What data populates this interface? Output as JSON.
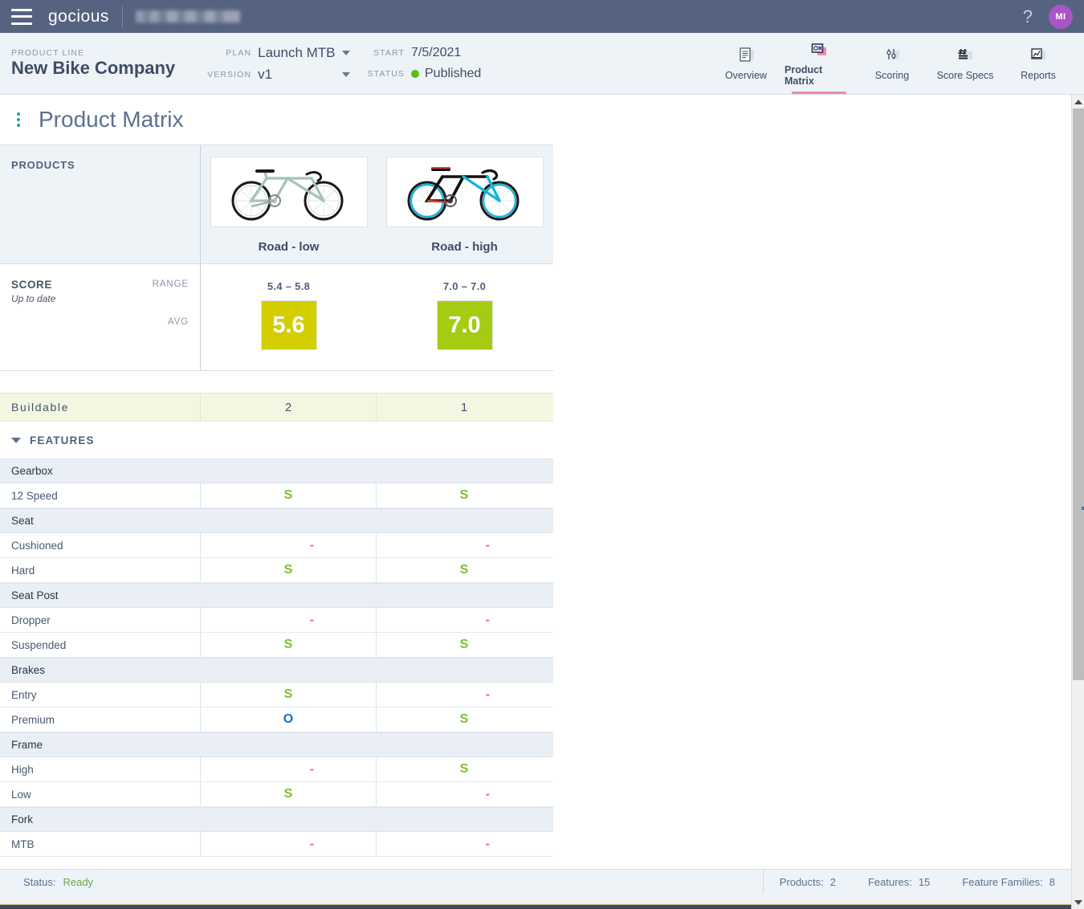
{
  "topbar": {
    "brand": "gocious",
    "redacted_label": "",
    "help_label": "?",
    "avatar_initials": "MI",
    "bg": "#566380"
  },
  "context": {
    "product_line_label": "PRODUCT LINE",
    "product_line_name": "New Bike Company",
    "plan_label": "PLAN",
    "plan_value": "Launch MTB",
    "version_label": "VERSION",
    "version_value": "v1",
    "start_label": "START",
    "start_value": "7/5/2021",
    "status_label": "STATUS",
    "status_value": "Published",
    "status_color": "#4fc11a"
  },
  "nav": {
    "items": [
      {
        "label": "Overview",
        "icon": "document-icon",
        "active": false
      },
      {
        "label": "Product Matrix",
        "icon": "matrix-icon",
        "active": true
      },
      {
        "label": "Scoring",
        "icon": "sliders-icon",
        "active": false
      },
      {
        "label": "Score Specs",
        "icon": "hash-lines-icon",
        "active": false
      },
      {
        "label": "Reports",
        "icon": "chart-icon",
        "active": false
      }
    ],
    "active_underline_color": "#f08ba8"
  },
  "page": {
    "title": "Product Matrix",
    "menu_icon": "kebab-menu-icon"
  },
  "matrix": {
    "products_label": "PRODUCTS",
    "products": [
      {
        "name": "Road - low",
        "thumb": "road-bike-low-image"
      },
      {
        "name": "Road - high",
        "thumb": "road-bike-high-image"
      }
    ],
    "score": {
      "title": "SCORE",
      "subtitle": "Up to date",
      "range_label": "RANGE",
      "avg_label": "AVG",
      "cells": [
        {
          "range": "5.4 – 5.8",
          "avg": "5.6",
          "color": "#d2ce00"
        },
        {
          "range": "7.0 – 7.0",
          "avg": "7.0",
          "color": "#a5cc12"
        }
      ]
    },
    "buildable": {
      "label": "Buildable",
      "values": [
        "2",
        "1"
      ],
      "bg": "#f3f7e1"
    },
    "features_header": "FEATURES",
    "families": [
      {
        "name": "Gearbox",
        "features": [
          {
            "name": "12 Speed",
            "marks": [
              "S",
              "S"
            ]
          }
        ]
      },
      {
        "name": "Seat",
        "features": [
          {
            "name": "Cushioned",
            "marks": [
              "-",
              "-"
            ]
          },
          {
            "name": "Hard",
            "marks": [
              "S",
              "S"
            ]
          }
        ]
      },
      {
        "name": "Seat Post",
        "features": [
          {
            "name": "Dropper",
            "marks": [
              "-",
              "-"
            ]
          },
          {
            "name": "Suspended",
            "marks": [
              "S",
              "S"
            ]
          }
        ]
      },
      {
        "name": "Brakes",
        "features": [
          {
            "name": "Entry",
            "marks": [
              "S",
              "-"
            ]
          },
          {
            "name": "Premium",
            "marks": [
              "O",
              "S"
            ]
          }
        ]
      },
      {
        "name": "Frame",
        "features": [
          {
            "name": "High",
            "marks": [
              "-",
              "S"
            ]
          },
          {
            "name": "Low",
            "marks": [
              "S",
              "-"
            ]
          }
        ]
      },
      {
        "name": "Fork",
        "features": [
          {
            "name": "MTB",
            "marks": [
              "-",
              "-"
            ]
          }
        ]
      }
    ],
    "mark_colors": {
      "S": "#7ac12e",
      "O": "#0a74cf",
      "dash": "#ef4f7e"
    }
  },
  "statusbar": {
    "status_label": "Status:",
    "status_value": "Ready",
    "stats": [
      {
        "key": "Products:",
        "value": "2"
      },
      {
        "key": "Features:",
        "value": "15"
      },
      {
        "key": "Feature Families:",
        "value": "8"
      }
    ]
  }
}
